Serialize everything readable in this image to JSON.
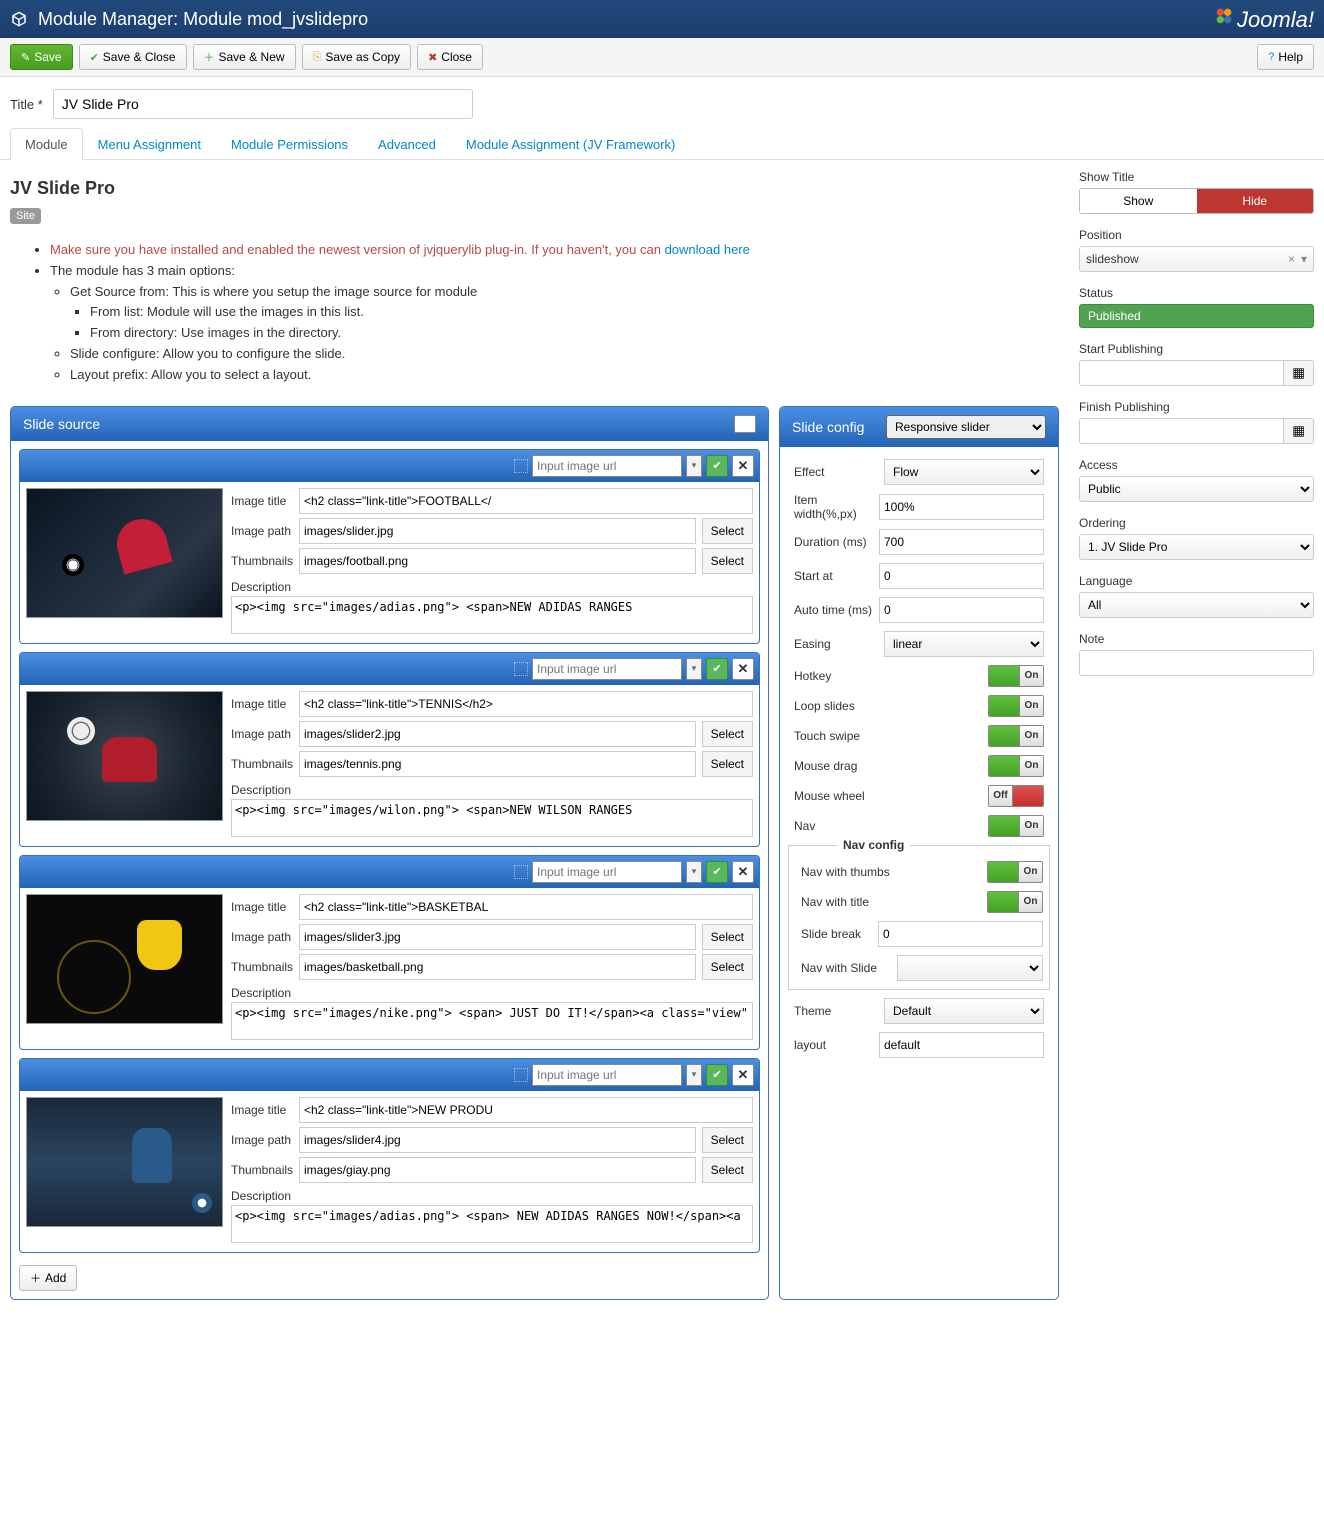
{
  "topbar": {
    "title": "Module Manager: Module mod_jvslidepro",
    "brand": "Joomla!"
  },
  "toolbar": {
    "save": "Save",
    "save_close": "Save & Close",
    "save_new": "Save & New",
    "save_copy": "Save as Copy",
    "close": "Close",
    "help": "Help"
  },
  "title_field": {
    "label": "Title *",
    "value": "JV Slide Pro"
  },
  "tabs": [
    "Module",
    "Menu Assignment",
    "Module Permissions",
    "Advanced",
    "Module Assignment (JV Framework)"
  ],
  "module": {
    "name": "JV Slide Pro",
    "site_badge": "Site"
  },
  "info": {
    "warning_prefix": "Make sure you have installed and enabled the newest version of jvjquerylib plug-in. If you haven't, you can ",
    "warning_link": "download here",
    "line2": "The module has 3 main options:",
    "opt1": "Get Source from: This is where you setup the image source for module",
    "opt1a": "From list: Module will use the images in this list.",
    "opt1b": "From directory: Use images in the directory.",
    "opt2": "Slide configure: Allow you to configure the slide.",
    "opt3": "Layout prefix: Allow you to select a layout."
  },
  "slide_source": {
    "header": "Slide source",
    "placeholder": "Input image url",
    "labels": {
      "title": "Image title",
      "path": "Image path",
      "thumbs": "Thumbnails",
      "desc": "Description",
      "select": "Select"
    },
    "add": "Add",
    "items": [
      {
        "title": "<h2 class=\"link-title\">FOOTBALL</",
        "path": "images/slider.jpg",
        "thumb": "images/football.png",
        "desc": "<p><img src=\"images/adias.png\"> <span>NEW ADIDAS RANGES"
      },
      {
        "title": "<h2 class=\"link-title\">TENNIS</h2>",
        "path": "images/slider2.jpg",
        "thumb": "images/tennis.png",
        "desc": "<p><img src=\"images/wilon.png\"> <span>NEW WILSON RANGES"
      },
      {
        "title": "<h2 class=\"link-title\">BASKETBAL",
        "path": "images/slider3.jpg",
        "thumb": "images/basketball.png",
        "desc": "<p><img src=\"images/nike.png\"> <span> JUST DO IT!</span><a class=\"view\""
      },
      {
        "title": "<h2 class=\"link-title\">NEW PRODU",
        "path": "images/slider4.jpg",
        "thumb": "images/giay.png",
        "desc": "<p><img src=\"images/adias.png\"> <span> NEW ADIDAS RANGES NOW!</span><a"
      }
    ]
  },
  "slide_config": {
    "header": "Slide config",
    "type": "Responsive slider",
    "rows": {
      "effect": {
        "label": "Effect",
        "value": "Flow"
      },
      "item_width": {
        "label": "Item width(%,px)",
        "value": "100%"
      },
      "duration": {
        "label": "Duration (ms)",
        "value": "700"
      },
      "start_at": {
        "label": "Start at",
        "value": "0"
      },
      "auto_time": {
        "label": "Auto time (ms)",
        "value": "0"
      },
      "easing": {
        "label": "Easing",
        "value": "linear"
      },
      "hotkey": {
        "label": "Hotkey",
        "value": "On"
      },
      "loop": {
        "label": "Loop slides",
        "value": "On"
      },
      "touch": {
        "label": "Touch swipe",
        "value": "On"
      },
      "drag": {
        "label": "Mouse drag",
        "value": "On"
      },
      "wheel": {
        "label": "Mouse wheel",
        "value": "Off"
      },
      "nav": {
        "label": "Nav",
        "value": "On"
      },
      "nav_config": "Nav config",
      "nav_thumbs": {
        "label": "Nav with thumbs",
        "value": "On"
      },
      "nav_title": {
        "label": "Nav with title",
        "value": "On"
      },
      "slide_break": {
        "label": "Slide break",
        "value": "0"
      },
      "nav_slide": {
        "label": "Nav with Slide",
        "value": ""
      },
      "theme": {
        "label": "Theme",
        "value": "Default"
      },
      "layout": {
        "label": "layout",
        "value": "default"
      }
    }
  },
  "sidebar": {
    "show_title": {
      "label": "Show Title",
      "show": "Show",
      "hide": "Hide"
    },
    "position": {
      "label": "Position",
      "value": "slideshow"
    },
    "status": {
      "label": "Status",
      "value": "Published"
    },
    "start_pub": {
      "label": "Start Publishing"
    },
    "finish_pub": {
      "label": "Finish Publishing"
    },
    "access": {
      "label": "Access",
      "value": "Public"
    },
    "ordering": {
      "label": "Ordering",
      "value": "1. JV Slide Pro"
    },
    "language": {
      "label": "Language",
      "value": "All"
    },
    "note": {
      "label": "Note"
    }
  }
}
